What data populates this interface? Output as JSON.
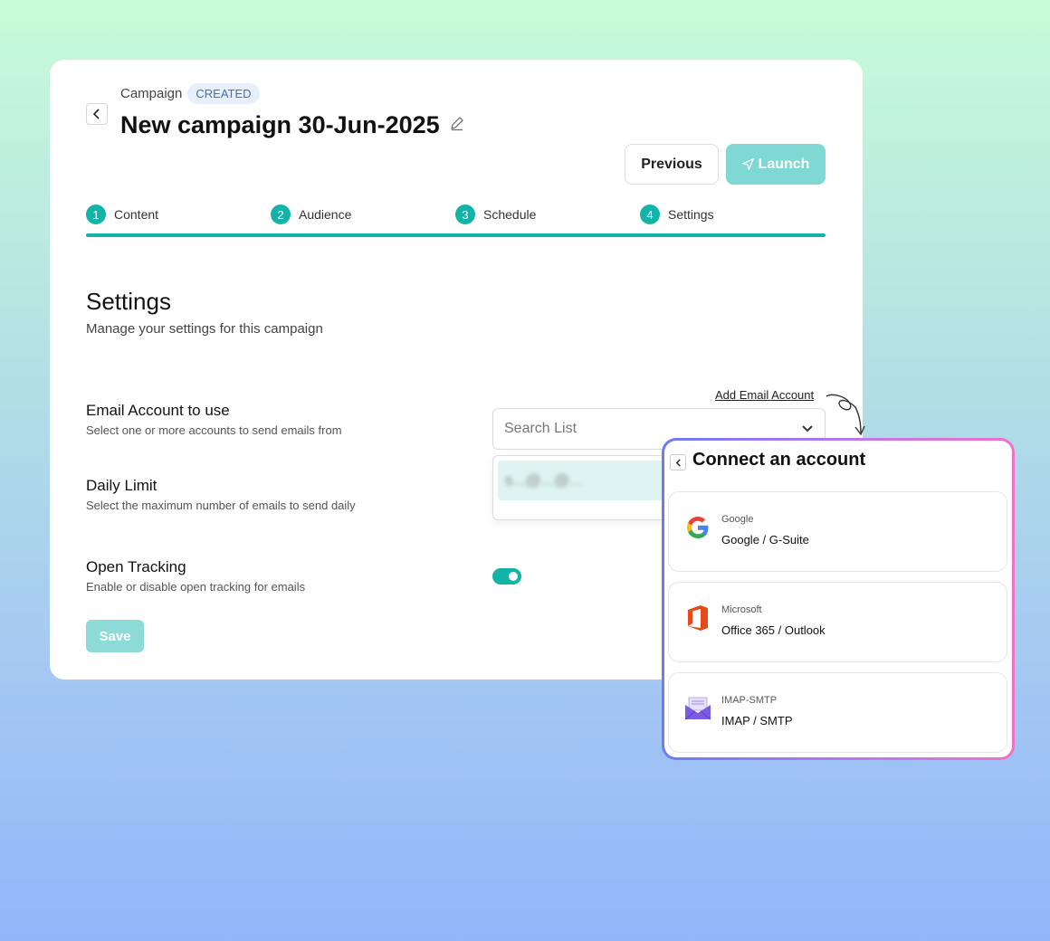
{
  "header": {
    "breadcrumb": "Campaign",
    "status_badge": "CREATED",
    "title": "New campaign 30-Jun-2025",
    "previous_label": "Previous",
    "launch_label": "Launch"
  },
  "steps": [
    {
      "num": "1",
      "label": "Content"
    },
    {
      "num": "2",
      "label": "Audience"
    },
    {
      "num": "3",
      "label": "Schedule"
    },
    {
      "num": "4",
      "label": "Settings"
    }
  ],
  "settings": {
    "title": "Settings",
    "subtitle": "Manage your settings for this campaign",
    "email_account": {
      "label": "Email Account to use",
      "description": "Select one or more accounts to send emails from",
      "add_link": "Add Email Account",
      "search_placeholder": "Search List",
      "dropdown_item": "s...@...@..."
    },
    "daily_limit": {
      "label": "Daily Limit",
      "description": "Select the maximum number of emails to send daily"
    },
    "open_tracking": {
      "label": "Open Tracking",
      "description": "Enable or disable open tracking for emails",
      "enabled": true
    },
    "save_label": "Save"
  },
  "connect_popup": {
    "title": "Connect an account",
    "providers": [
      {
        "category": "Google",
        "name": "Google / G-Suite",
        "icon": "google-icon"
      },
      {
        "category": "Microsoft",
        "name": "Office 365 / Outlook",
        "icon": "office-icon"
      },
      {
        "category": "IMAP-SMTP",
        "name": "IMAP / SMTP",
        "icon": "mail-icon"
      }
    ]
  },
  "colors": {
    "accent": "#14b3a8",
    "launch_disabled": "#7fd8d3",
    "save_disabled": "#8ddbd6",
    "badge_bg": "#e6effa",
    "popup_border_gradient": [
      "#6e7bf2",
      "#c377e8",
      "#ef72c8"
    ]
  }
}
